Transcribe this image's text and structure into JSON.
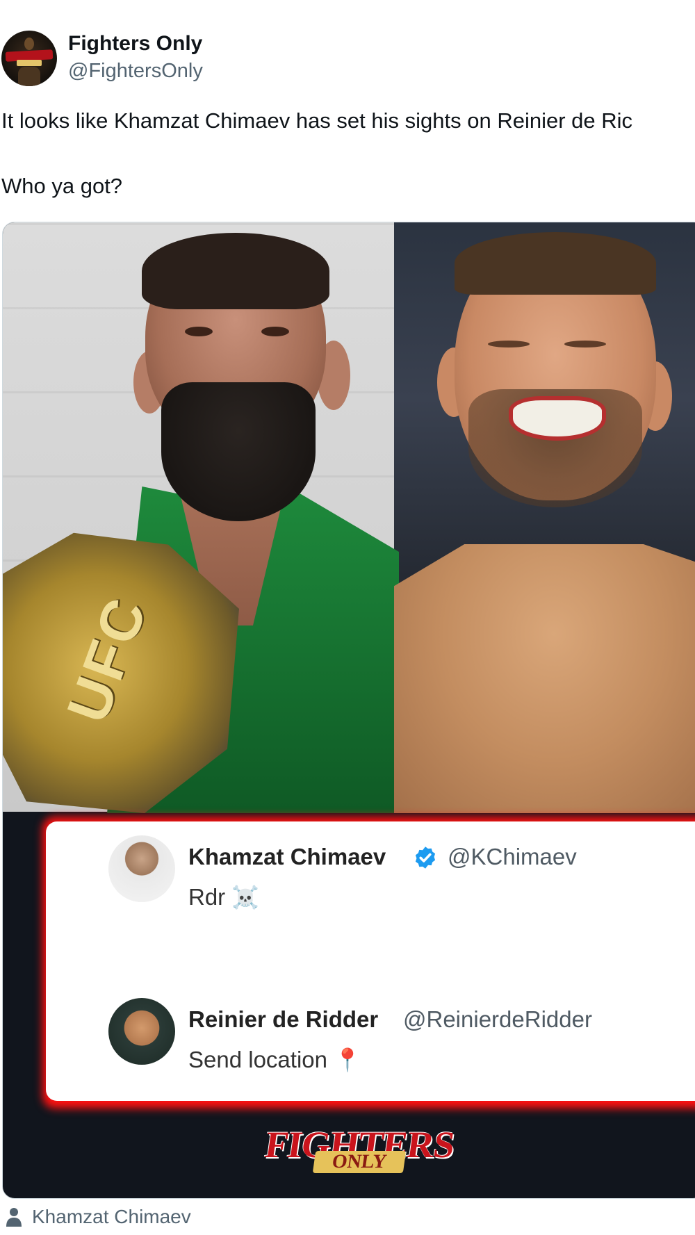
{
  "author": {
    "name": "Fighters Only",
    "handle": "@FightersOnly",
    "avatar_icon": "fighters-only-logo-icon"
  },
  "tweet": {
    "line1": "It looks like Khamzat Chimaev has set his sights on Reinier de Ric",
    "line2": "Who ya got?"
  },
  "media": {
    "belt_text": "UFC",
    "embedded_posts": [
      {
        "name": "Khamzat Chimaev",
        "handle": "@KChimaev",
        "verified": true,
        "text": "Rdr",
        "emoji": "☠️"
      },
      {
        "name": "Reinier de Ridder",
        "handle": "@ReinierdeRidder",
        "verified": false,
        "text": "Send location",
        "emoji": "📍"
      }
    ],
    "logo_main": "FIGHTERS",
    "logo_sub": "ONLY"
  },
  "footer": {
    "tag_icon": "person-icon",
    "tag_label": "Khamzat Chimaev"
  },
  "colors": {
    "accent_red": "#ff1111",
    "verified_blue": "#1d9bf0",
    "text_secondary": "#536471"
  }
}
